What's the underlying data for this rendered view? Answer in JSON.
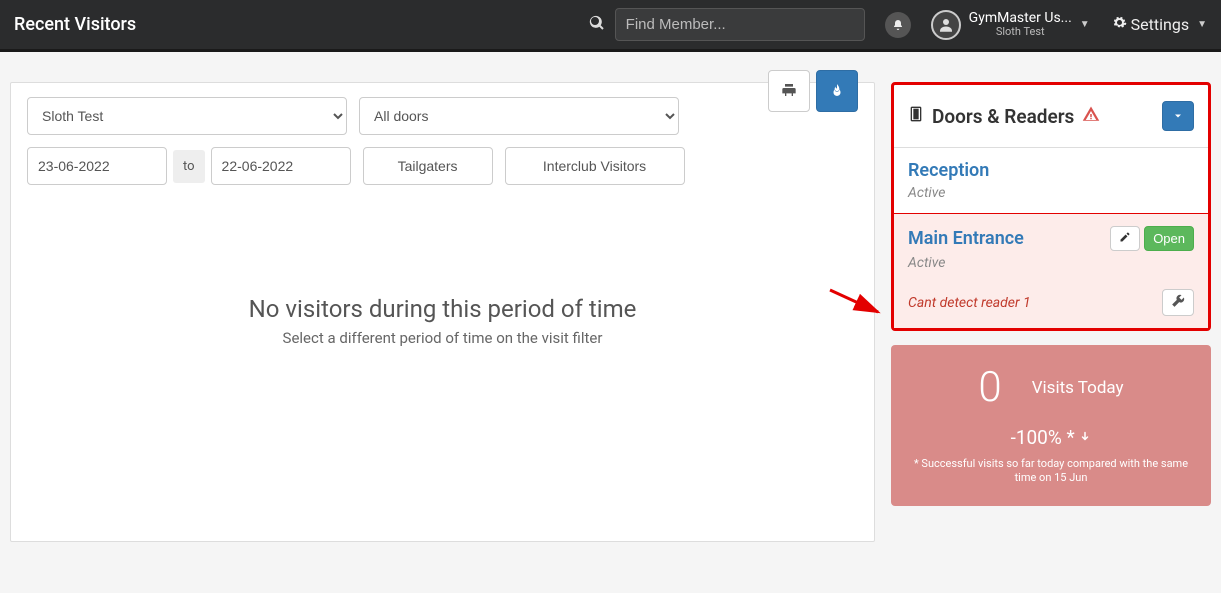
{
  "header": {
    "title": "Recent Visitors",
    "search_placeholder": "Find Member...",
    "user_name": "GymMaster Us...",
    "user_sub": "Sloth Test",
    "settings_label": "Settings"
  },
  "filters": {
    "location_selected": "Sloth Test",
    "doors_selected": "All doors",
    "date_from": "23-06-2022",
    "to_label": "to",
    "date_to": "22-06-2022",
    "tailgaters_btn": "Tailgaters",
    "interclub_btn": "Interclub Visitors"
  },
  "empty": {
    "title": "No visitors during this period of time",
    "sub": "Select a different period of time on the visit filter"
  },
  "doors_panel": {
    "title": "Doors & Readers",
    "items": [
      {
        "name": "Reception",
        "status": "Active"
      },
      {
        "name": "Main Entrance",
        "status": "Active",
        "open_label": "Open",
        "error": "Cant detect reader 1"
      }
    ]
  },
  "visits": {
    "count": "0",
    "label": "Visits Today",
    "pct": "-100% *",
    "note": "* Successful visits so far today compared with the same time on 15 Jun"
  }
}
